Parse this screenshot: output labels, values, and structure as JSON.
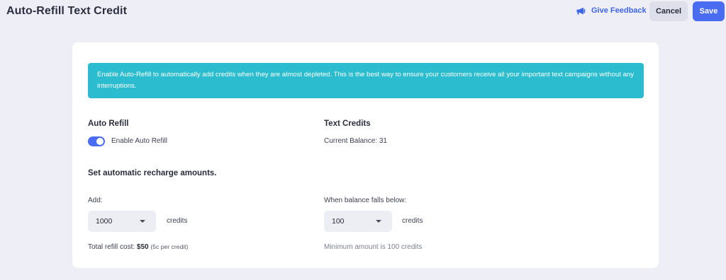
{
  "header": {
    "title": "Auto-Refill Text Credit",
    "feedback_label": "Give Feedback",
    "feedback_icon": "megaphone-icon",
    "cancel_label": "Cancel",
    "save_label": "Save"
  },
  "banner": {
    "text": "Enable Auto-Refill to automatically add credits when they are almost depleted. This is the best way to ensure your customers receive all your important text campaigns without any interruptions."
  },
  "auto_refill": {
    "title": "Auto Refill",
    "toggle_label": "Enable Auto Refill",
    "enabled": true
  },
  "text_credits": {
    "title": "Text Credits",
    "balance": "Current Balance: 31"
  },
  "recharge": {
    "heading": "Set automatic recharge amounts.",
    "add_label": "Add:",
    "add_value": "1000",
    "add_unit": "credits",
    "cost_prefix": "Total refill cost:",
    "cost_value": "$50",
    "cost_note": "(5c per credit)",
    "threshold_label": "When balance falls below:",
    "threshold_value": "100",
    "threshold_unit": "credits",
    "threshold_hint": "Minimum amount is 100 credits"
  },
  "colors": {
    "accent": "#4a6cf3",
    "banner": "#2bbdcf",
    "background": "#eeeff6"
  }
}
